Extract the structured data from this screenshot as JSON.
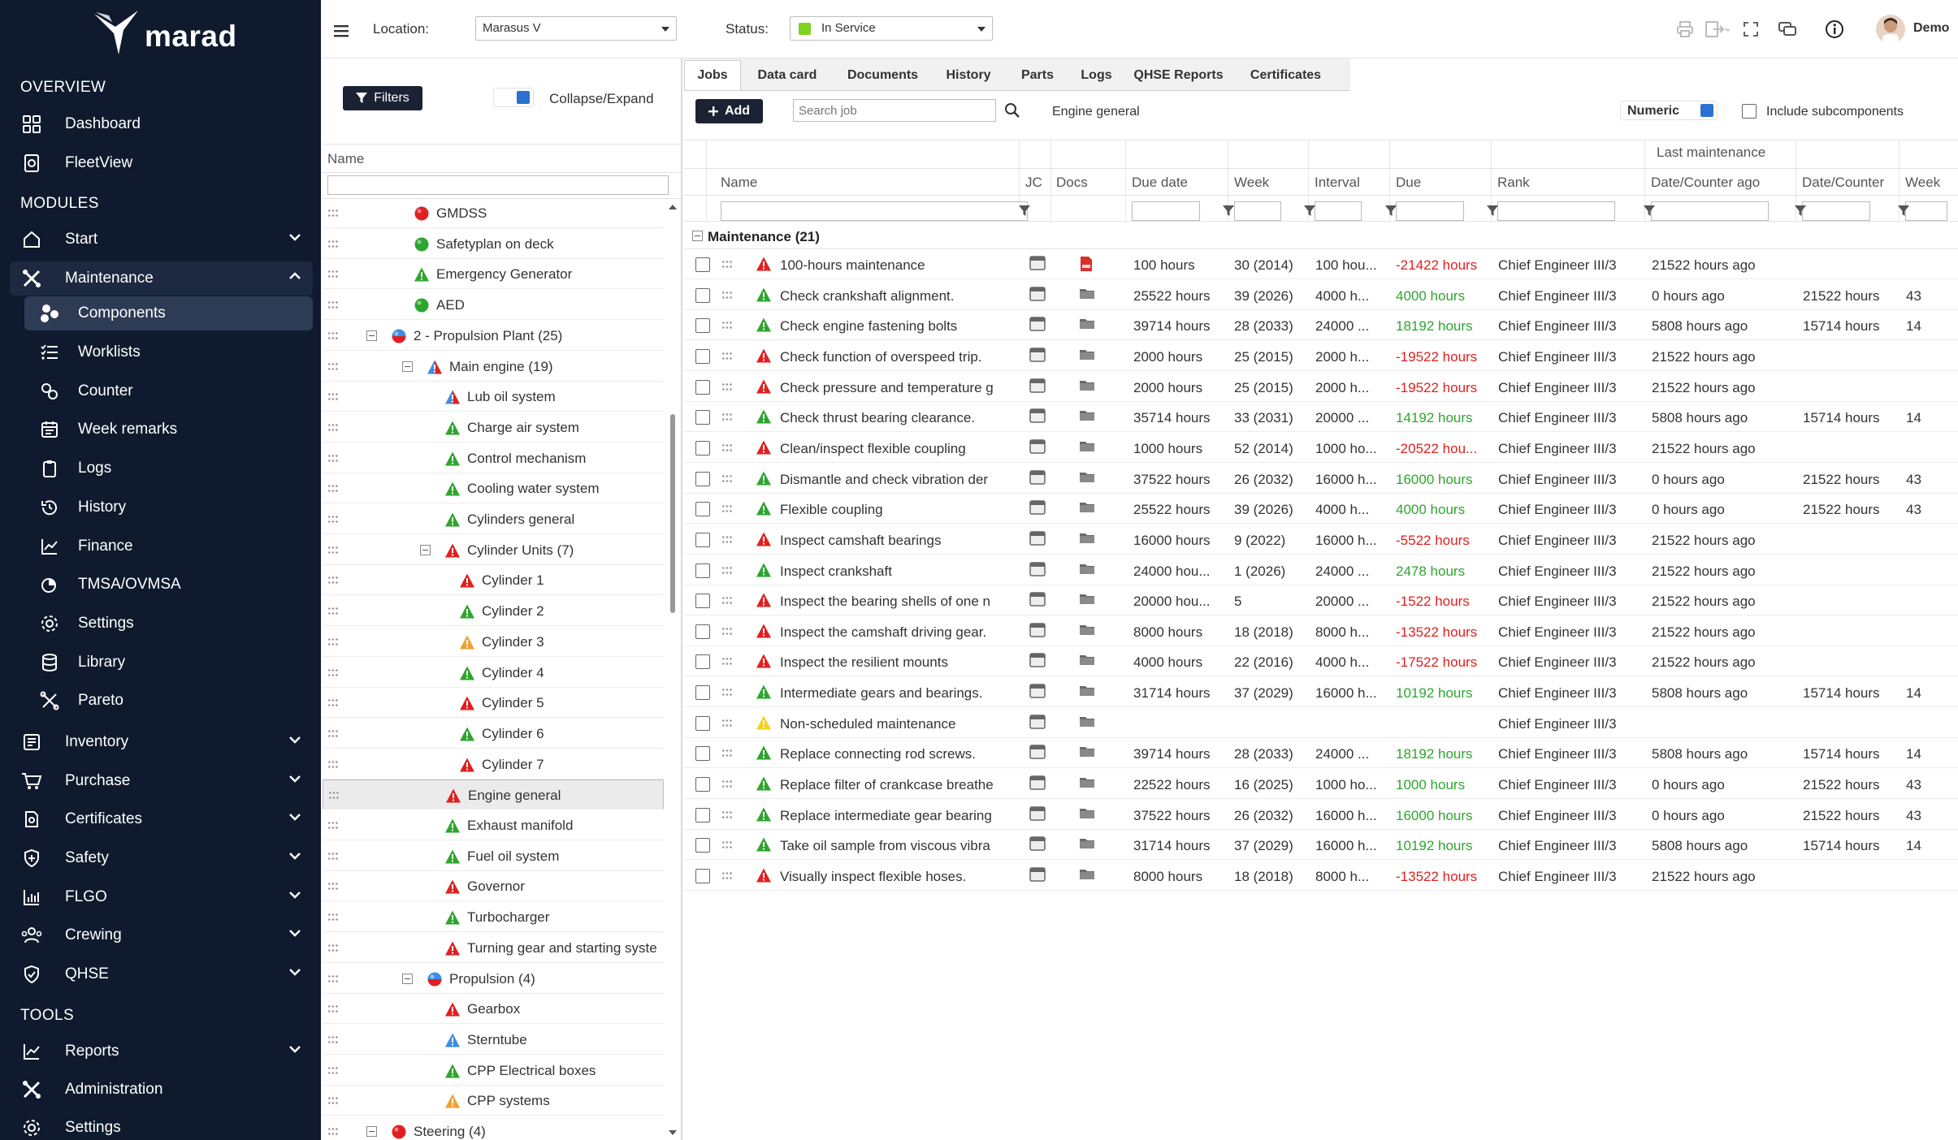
{
  "app": {
    "logo_text": "marad"
  },
  "sidebar": {
    "overview_label": "OVERVIEW",
    "overview": [
      {
        "label": "Dashboard",
        "icon": "dashboard-icon"
      },
      {
        "label": "FleetView",
        "icon": "fleetview-icon"
      }
    ],
    "modules_label": "MODULES",
    "modules": [
      {
        "label": "Start",
        "icon": "start-icon"
      },
      {
        "label": "Maintenance",
        "icon": "maintenance-icon"
      }
    ],
    "maintenance_sub": [
      {
        "label": "Components",
        "icon": "components-icon"
      },
      {
        "label": "Worklists",
        "icon": "worklists-icon"
      },
      {
        "label": "Counter",
        "icon": "counter-icon"
      },
      {
        "label": "Week remarks",
        "icon": "week-remarks-icon"
      },
      {
        "label": "Logs",
        "icon": "logs-icon"
      },
      {
        "label": "History",
        "icon": "history-icon"
      },
      {
        "label": "Finance",
        "icon": "finance-icon"
      },
      {
        "label": "TMSA/OVMSA",
        "icon": "tmsa-icon"
      },
      {
        "label": "Settings",
        "icon": "settings-icon"
      },
      {
        "label": "Library",
        "icon": "library-icon"
      },
      {
        "label": "Pareto",
        "icon": "pareto-icon"
      }
    ],
    "modules_more": [
      {
        "label": "Inventory",
        "icon": "inventory-icon"
      },
      {
        "label": "Purchase",
        "icon": "purchase-icon"
      },
      {
        "label": "Certificates",
        "icon": "certificates-icon"
      },
      {
        "label": "Safety",
        "icon": "safety-icon"
      },
      {
        "label": "FLGO",
        "icon": "flgo-icon"
      },
      {
        "label": "Crewing",
        "icon": "crewing-icon"
      },
      {
        "label": "QHSE",
        "icon": "qhse-icon"
      }
    ],
    "tools_label": "TOOLS",
    "tools": [
      {
        "label": "Reports",
        "icon": "reports-icon"
      },
      {
        "label": "Administration",
        "icon": "administration-icon"
      },
      {
        "label": "Settings",
        "icon": "settings-icon"
      }
    ]
  },
  "topbar": {
    "location_label": "Location:",
    "location_value": "Marasus V",
    "status_label": "Status:",
    "status_value": "In Service",
    "status_color": "#7ed321",
    "user_name": "Demo"
  },
  "tree": {
    "filters_label": "Filters",
    "collapse_label": "Collapse/Expand",
    "name_header": "Name",
    "rows": [
      {
        "label": "GMDSS",
        "indent": 0,
        "icon": "circle-red",
        "toggle": false
      },
      {
        "label": "Safetyplan on deck",
        "indent": 0,
        "icon": "circle-green",
        "toggle": false
      },
      {
        "label": "Emergency Generator",
        "indent": 0,
        "icon": "tri-green",
        "toggle": false
      },
      {
        "label": "AED",
        "indent": 0,
        "icon": "circle-green",
        "toggle": false
      },
      {
        "label": "2 - Propulsion Plant (25)",
        "indent": -1,
        "icon": "circle-mixed",
        "toggle": true
      },
      {
        "label": "Main engine (19)",
        "indent": 1,
        "icon": "tri-mixed",
        "toggle": true
      },
      {
        "label": "Lub oil system",
        "indent": 2,
        "icon": "tri-mixed",
        "toggle": false
      },
      {
        "label": "Charge air system",
        "indent": 2,
        "icon": "tri-green",
        "toggle": false
      },
      {
        "label": "Control mechanism",
        "indent": 2,
        "icon": "tri-green",
        "toggle": false
      },
      {
        "label": "Cooling water system",
        "indent": 2,
        "icon": "tri-green",
        "toggle": false
      },
      {
        "label": "Cylinders general",
        "indent": 2,
        "icon": "tri-green",
        "toggle": false
      },
      {
        "label": "Cylinder Units (7)",
        "indent": 2,
        "icon": "tri-red",
        "toggle": true
      },
      {
        "label": "Cylinder 1",
        "indent": 3,
        "icon": "tri-red",
        "toggle": false
      },
      {
        "label": "Cylinder 2",
        "indent": 3,
        "icon": "tri-green",
        "toggle": false
      },
      {
        "label": "Cylinder 3",
        "indent": 3,
        "icon": "tri-orange",
        "toggle": false
      },
      {
        "label": "Cylinder 4",
        "indent": 3,
        "icon": "tri-green",
        "toggle": false
      },
      {
        "label": "Cylinder 5",
        "indent": 3,
        "icon": "tri-red",
        "toggle": false
      },
      {
        "label": "Cylinder 6",
        "indent": 3,
        "icon": "tri-green",
        "toggle": false
      },
      {
        "label": "Cylinder 7",
        "indent": 3,
        "icon": "tri-red",
        "toggle": false
      },
      {
        "label": "Engine general",
        "indent": 2,
        "icon": "tri-red",
        "toggle": false,
        "selected": true
      },
      {
        "label": "Exhaust manifold",
        "indent": 2,
        "icon": "tri-green",
        "toggle": false
      },
      {
        "label": "Fuel oil system",
        "indent": 2,
        "icon": "tri-green",
        "toggle": false
      },
      {
        "label": "Governor",
        "indent": 2,
        "icon": "tri-red",
        "toggle": false
      },
      {
        "label": "Turbocharger",
        "indent": 2,
        "icon": "tri-green",
        "toggle": false
      },
      {
        "label": "Turning gear and starting syste",
        "indent": 2,
        "icon": "tri-red",
        "toggle": false
      },
      {
        "label": "Propulsion (4)",
        "indent": 1,
        "icon": "circle-mixed",
        "toggle": true
      },
      {
        "label": "Gearbox",
        "indent": 2,
        "icon": "tri-red",
        "toggle": false
      },
      {
        "label": "Sterntube",
        "indent": 2,
        "icon": "tri-blue",
        "toggle": false
      },
      {
        "label": "CPP Electrical boxes",
        "indent": 2,
        "icon": "tri-green",
        "toggle": false
      },
      {
        "label": "CPP systems",
        "indent": 2,
        "icon": "tri-orange",
        "toggle": false
      },
      {
        "label": "Steering (4)",
        "indent": -1,
        "icon": "circle-red",
        "toggle": true
      }
    ]
  },
  "jobs": {
    "tabs": [
      "Jobs",
      "Data card",
      "Documents",
      "History",
      "Parts",
      "Logs",
      "QHSE Reports",
      "Certificates"
    ],
    "add_label": "Add",
    "search_placeholder": "Search job",
    "context_label": "Engine general",
    "numeric_label": "Numeric",
    "include_sub_label": "Include subcomponents",
    "last_maintenance_label": "Last maintenance",
    "headers": [
      "Name",
      "JC",
      "Docs",
      "Due date",
      "Week",
      "Interval",
      "Due",
      "Rank",
      "Date/Counter ago",
      "Date/Counter",
      "Week"
    ],
    "group_label": "Maintenance (21)",
    "rows": [
      {
        "status": "red",
        "name": "100-hours maintenance",
        "doc": "pdf",
        "due_date": "100 hours",
        "week": "30 (2014)",
        "interval": "100 hou...",
        "due": "-21422 hours",
        "due_color": "red",
        "rank": "Chief Engineer III/3",
        "ago": "21522 hours ago",
        "counter": "",
        "week2": ""
      },
      {
        "status": "green",
        "name": "Check crankshaft alignment.",
        "doc": "folder",
        "due_date": "25522 hours",
        "week": "39 (2026)",
        "interval": "4000 h...",
        "due": "4000 hours",
        "due_color": "green",
        "rank": "Chief Engineer III/3",
        "ago": "0 hours ago",
        "counter": "21522 hours",
        "week2": "43"
      },
      {
        "status": "green",
        "name": "Check engine fastening bolts",
        "doc": "folder",
        "due_date": "39714 hours",
        "week": "28 (2033)",
        "interval": "24000 ...",
        "due": "18192 hours",
        "due_color": "green",
        "rank": "Chief Engineer III/3",
        "ago": "5808 hours ago",
        "counter": "15714 hours",
        "week2": "14"
      },
      {
        "status": "red",
        "name": "Check function of overspeed trip.",
        "doc": "folder",
        "due_date": "2000 hours",
        "week": "25 (2015)",
        "interval": "2000 h...",
        "due": "-19522 hours",
        "due_color": "red",
        "rank": "Chief Engineer III/3",
        "ago": "21522 hours ago",
        "counter": "",
        "week2": ""
      },
      {
        "status": "red",
        "name": "Check pressure and temperature g",
        "doc": "folder",
        "due_date": "2000 hours",
        "week": "25 (2015)",
        "interval": "2000 h...",
        "due": "-19522 hours",
        "due_color": "red",
        "rank": "Chief Engineer III/3",
        "ago": "21522 hours ago",
        "counter": "",
        "week2": ""
      },
      {
        "status": "green",
        "name": "Check thrust bearing clearance.",
        "doc": "folder",
        "due_date": "35714 hours",
        "week": "33 (2031)",
        "interval": "20000 ...",
        "due": "14192 hours",
        "due_color": "green",
        "rank": "Chief Engineer III/3",
        "ago": "5808 hours ago",
        "counter": "15714 hours",
        "week2": "14"
      },
      {
        "status": "red",
        "name": "Clean/inspect flexible coupling",
        "doc": "folder",
        "due_date": "1000 hours",
        "week": "52 (2014)",
        "interval": "1000 ho...",
        "due": "-20522 hou...",
        "due_color": "red",
        "rank": "Chief Engineer III/3",
        "ago": "21522 hours ago",
        "counter": "",
        "week2": ""
      },
      {
        "status": "green",
        "name": "Dismantle and check vibration der",
        "doc": "folder",
        "due_date": "37522 hours",
        "week": "26 (2032)",
        "interval": "16000 h...",
        "due": "16000 hours",
        "due_color": "green",
        "rank": "Chief Engineer III/3",
        "ago": "0 hours ago",
        "counter": "21522 hours",
        "week2": "43"
      },
      {
        "status": "green",
        "name": "Flexible coupling",
        "doc": "folder",
        "due_date": "25522 hours",
        "week": "39 (2026)",
        "interval": "4000 h...",
        "due": "4000 hours",
        "due_color": "green",
        "rank": "Chief Engineer III/3",
        "ago": "0 hours ago",
        "counter": "21522 hours",
        "week2": "43"
      },
      {
        "status": "red",
        "name": "Inspect camshaft bearings",
        "doc": "folder",
        "due_date": "16000 hours",
        "week": "9 (2022)",
        "interval": "16000 h...",
        "due": "-5522 hours",
        "due_color": "red",
        "rank": "Chief Engineer III/3",
        "ago": "21522 hours ago",
        "counter": "",
        "week2": ""
      },
      {
        "status": "green",
        "name": "Inspect crankshaft",
        "doc": "folder",
        "due_date": "24000 hou...",
        "week": "1 (2026)",
        "interval": "24000 ...",
        "due": "2478 hours",
        "due_color": "green",
        "rank": "Chief Engineer III/3",
        "ago": "21522 hours ago",
        "counter": "",
        "week2": ""
      },
      {
        "status": "red",
        "name": "Inspect the bearing shells of one n",
        "doc": "folder",
        "due_date": "20000 hou...",
        "week": "5",
        "interval": "20000 ...",
        "due": "-1522 hours",
        "due_color": "red",
        "rank": "Chief Engineer III/3",
        "ago": "21522 hours ago",
        "counter": "",
        "week2": ""
      },
      {
        "status": "red",
        "name": "Inspect the camshaft driving gear.",
        "doc": "folder",
        "due_date": "8000 hours",
        "week": "18 (2018)",
        "interval": "8000 h...",
        "due": "-13522 hours",
        "due_color": "red",
        "rank": "Chief Engineer III/3",
        "ago": "21522 hours ago",
        "counter": "",
        "week2": ""
      },
      {
        "status": "red",
        "name": "Inspect the resilient mounts",
        "doc": "folder",
        "due_date": "4000 hours",
        "week": "22 (2016)",
        "interval": "4000 h...",
        "due": "-17522 hours",
        "due_color": "red",
        "rank": "Chief Engineer III/3",
        "ago": "21522 hours ago",
        "counter": "",
        "week2": ""
      },
      {
        "status": "green",
        "name": "Intermediate gears and bearings.",
        "doc": "folder",
        "due_date": "31714 hours",
        "week": "37 (2029)",
        "interval": "16000 h...",
        "due": "10192 hours",
        "due_color": "green",
        "rank": "Chief Engineer III/3",
        "ago": "5808 hours ago",
        "counter": "15714 hours",
        "week2": "14"
      },
      {
        "status": "yellow",
        "name": "Non-scheduled maintenance",
        "doc": "folder",
        "due_date": "",
        "week": "",
        "interval": "",
        "due": "",
        "due_color": "green",
        "rank": "Chief Engineer III/3",
        "ago": "",
        "counter": "",
        "week2": ""
      },
      {
        "status": "green",
        "name": "Replace connecting rod screws.",
        "doc": "folder",
        "due_date": "39714 hours",
        "week": "28 (2033)",
        "interval": "24000 ...",
        "due": "18192 hours",
        "due_color": "green",
        "rank": "Chief Engineer III/3",
        "ago": "5808 hours ago",
        "counter": "15714 hours",
        "week2": "14"
      },
      {
        "status": "green",
        "name": "Replace filter of crankcase breathe",
        "doc": "folder",
        "due_date": "22522 hours",
        "week": "16 (2025)",
        "interval": "1000 ho...",
        "due": "1000 hours",
        "due_color": "green",
        "rank": "Chief Engineer III/3",
        "ago": "0 hours ago",
        "counter": "21522 hours",
        "week2": "43"
      },
      {
        "status": "green",
        "name": "Replace intermediate gear bearing",
        "doc": "folder",
        "due_date": "37522 hours",
        "week": "26 (2032)",
        "interval": "16000 h...",
        "due": "16000 hours",
        "due_color": "green",
        "rank": "Chief Engineer III/3",
        "ago": "0 hours ago",
        "counter": "21522 hours",
        "week2": "43"
      },
      {
        "status": "green",
        "name": "Take oil sample from viscous vibra",
        "doc": "folder",
        "due_date": "31714 hours",
        "week": "37 (2029)",
        "interval": "16000 h...",
        "due": "10192 hours",
        "due_color": "green",
        "rank": "Chief Engineer III/3",
        "ago": "5808 hours ago",
        "counter": "15714 hours",
        "week2": "14"
      },
      {
        "status": "red",
        "name": "Visually inspect flexible hoses.",
        "doc": "folder",
        "due_date": "8000 hours",
        "week": "18 (2018)",
        "interval": "8000 h...",
        "due": "-13522 hours",
        "due_color": "red",
        "rank": "Chief Engineer III/3",
        "ago": "21522 hours ago",
        "counter": "",
        "week2": ""
      }
    ]
  },
  "colors": {
    "sidebar_bg": "#0f1a2e",
    "red": "#e02020",
    "green": "#2ea52e",
    "orange": "#f0a030",
    "blue": "#3a8ee6",
    "accent_blue": "#2a72d0"
  }
}
